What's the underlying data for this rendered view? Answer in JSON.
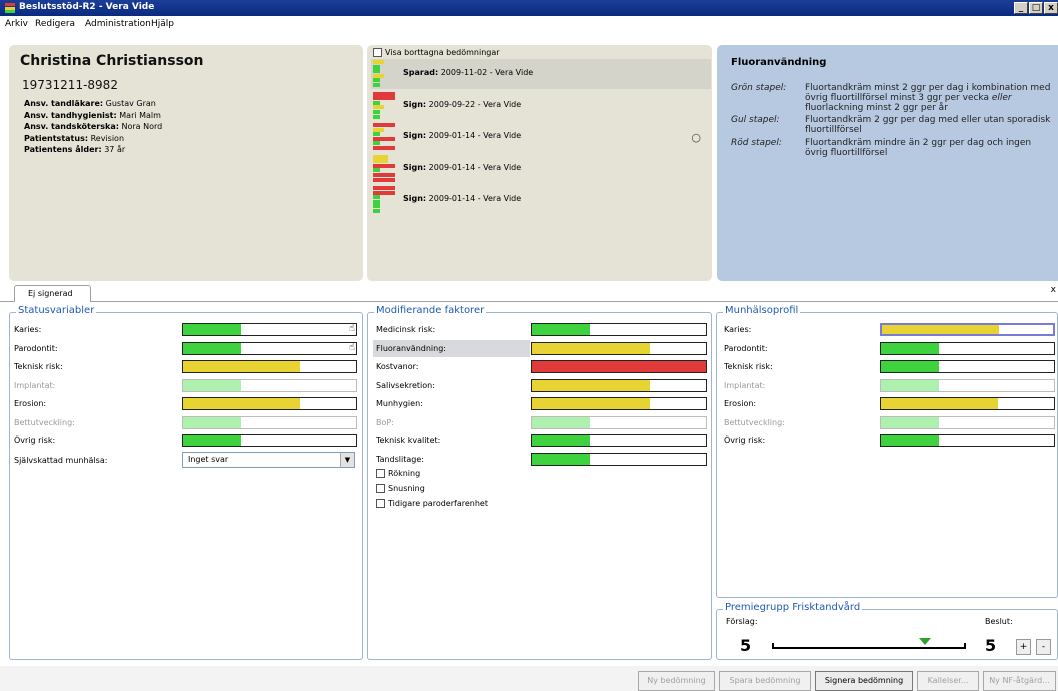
{
  "window": {
    "title": "Beslutsstöd-R2 - Vera Vide",
    "controls": [
      "_",
      "□",
      "x"
    ]
  },
  "menu": [
    "Arkiv",
    "Redigera",
    "Administration",
    "Hjälp"
  ],
  "patient": {
    "name": "Christina Christiansson",
    "id": "19731211-8982",
    "rows": [
      {
        "k": "Ansv. tandläkare:",
        "v": "Gustav Gran"
      },
      {
        "k": "Ansv. tandhygienist:",
        "v": "Mari Malm"
      },
      {
        "k": "Ansv. tandsköterska:",
        "v": "Nora Nord"
      },
      {
        "k": "Patientstatus:",
        "v": "Revision"
      },
      {
        "k": "Patientens ålder:",
        "v": "37 år"
      }
    ]
  },
  "assessments": {
    "show_removed_label": "Visa borttagna bedömningar",
    "show_removed_checked": false,
    "items": [
      {
        "status": "Sparad:",
        "text": "2009-11-02 - Vera Vide",
        "selected": true,
        "bold_text": true,
        "comment": false,
        "bars": [
          [
            "#e7d432",
            0.5
          ],
          [
            "#3fd23f",
            0.3
          ],
          [
            "#3fd23f",
            0.3
          ],
          [
            "#e7d432",
            0.5
          ],
          [
            "#3fd23f",
            0.3
          ],
          [
            "#3fd23f",
            0.3
          ]
        ]
      },
      {
        "status": "Sign:",
        "text": "2009-09-22 - Vera Vide",
        "selected": false,
        "bold_text": false,
        "comment": false,
        "bars": [
          [
            "#e03a3a",
            1.0
          ],
          [
            "#e03a3a",
            1.0
          ],
          [
            "#3fd23f",
            0.3
          ],
          [
            "#e7d432",
            0.5
          ],
          [
            "#3fd23f",
            0.3
          ],
          [
            "#3fd23f",
            0.3
          ]
        ]
      },
      {
        "status": "Sign:",
        "text": "2009-01-14 - Vera Vide",
        "selected": false,
        "bold_text": false,
        "comment": true,
        "bars": [
          [
            "#e03a3a",
            1.0
          ],
          [
            "#e7d432",
            0.5
          ],
          [
            "#3fd23f",
            0.3
          ],
          [
            "#e03a3a",
            1.0
          ],
          [
            "#3fd23f",
            0.3
          ],
          [
            "#e03a3a",
            1.0
          ]
        ]
      },
      {
        "status": "Sign:",
        "text": "2009-01-14 - Vera Vide",
        "selected": false,
        "bold_text": false,
        "comment": false,
        "bars": [
          [
            "#e7d432",
            0.7
          ],
          [
            "#e7d432",
            0.7
          ],
          [
            "#e03a3a",
            1.0
          ],
          [
            "#3fd23f",
            0.3
          ],
          [
            "#e03a3a",
            1.0
          ],
          [
            "#e03a3a",
            1.0
          ]
        ]
      },
      {
        "status": "Sign:",
        "text": "2009-01-14 - Vera Vide",
        "selected": false,
        "bold_text": false,
        "comment": false,
        "bars": [
          [
            "#e03a3a",
            1.0
          ],
          [
            "#e03a3a",
            1.0
          ],
          [
            "#3fd23f",
            0.3
          ],
          [
            "#3fd23f",
            0.3
          ],
          [
            "#3fd23f",
            0.3
          ],
          [
            "#3fd23f",
            0.3
          ]
        ]
      }
    ]
  },
  "fluor_info": {
    "title": "Fluoranvändning",
    "items": [
      {
        "key": "Grön stapel:",
        "desc_html": "Fluortandkräm minst 2 ggr per dag i kombination med övrig fluortillförsel minst 3 ggr per vecka <i>eller</i> fluorlackning minst 2 ggr per år"
      },
      {
        "key": "Gul stapel:",
        "desc_html": "Fluortandkräm 2 ggr per dag med eller utan sporadisk fluortillförsel"
      },
      {
        "key": "Röd stapel:",
        "desc_html": "Fluortandkräm mindre än 2 ggr per dag och ingen övrig fluortillförsel"
      }
    ]
  },
  "tab": {
    "label": "Ej signerad",
    "close": "x"
  },
  "status_vars": {
    "title": "Statusvariabler",
    "rows": [
      {
        "label": "Karies:",
        "color": "#3fd23f",
        "level": 0.33,
        "enabled": true,
        "hand": true
      },
      {
        "label": "Parodontit:",
        "color": "#3fd23f",
        "level": 0.33,
        "enabled": true,
        "hand": true
      },
      {
        "label": "Teknisk risk:",
        "color": "#e7d432",
        "level": 0.67,
        "enabled": true,
        "hand": false
      },
      {
        "label": "Implantat:",
        "color": "#aef0ae",
        "level": 0.33,
        "enabled": false,
        "hand": false
      },
      {
        "label": "Erosion:",
        "color": "#e7d432",
        "level": 0.67,
        "enabled": true,
        "hand": false
      },
      {
        "label": "Bettutveckling:",
        "color": "#aef0ae",
        "level": 0.33,
        "enabled": false,
        "hand": false
      },
      {
        "label": "Övrig risk:",
        "color": "#3fd23f",
        "level": 0.33,
        "enabled": true,
        "hand": false
      }
    ],
    "self_rated_label": "Självskattad munhälsa:",
    "self_rated_value": "Inget svar"
  },
  "modifying": {
    "title": "Modifierande faktorer",
    "rows": [
      {
        "label": "Medicinsk risk:",
        "color": "#3fd23f",
        "level": 0.33,
        "enabled": true,
        "selected": false
      },
      {
        "label": "Fluoranvändning:",
        "color": "#e7d432",
        "level": 0.67,
        "enabled": true,
        "selected": true
      },
      {
        "label": "Kostvanor:",
        "color": "#e03a3a",
        "level": 1.0,
        "enabled": true,
        "selected": false
      },
      {
        "label": "Salivsekretion:",
        "color": "#e7d432",
        "level": 0.67,
        "enabled": true,
        "selected": false
      },
      {
        "label": "Munhygien:",
        "color": "#e7d432",
        "level": 0.67,
        "enabled": true,
        "selected": false
      },
      {
        "label": "BoP:",
        "color": "#aef0ae",
        "level": 0.33,
        "enabled": false,
        "selected": false
      },
      {
        "label": "Teknisk kvalitet:",
        "color": "#3fd23f",
        "level": 0.33,
        "enabled": true,
        "selected": false
      },
      {
        "label": "Tandslitage:",
        "color": "#3fd23f",
        "level": 0.33,
        "enabled": true,
        "selected": false
      }
    ],
    "checkboxes": [
      {
        "label": "Rökning",
        "checked": false
      },
      {
        "label": "Snusning",
        "checked": false
      },
      {
        "label": "Tidigare paroderfarenhet",
        "checked": false
      }
    ]
  },
  "profile": {
    "title": "Munhälsoprofil",
    "rows": [
      {
        "label": "Karies:",
        "color": "#e7d432",
        "level": 0.67,
        "enabled": true,
        "highlight": true
      },
      {
        "label": "Parodontit:",
        "color": "#3fd23f",
        "level": 0.33,
        "enabled": true,
        "highlight": false
      },
      {
        "label": "Teknisk risk:",
        "color": "#3fd23f",
        "level": 0.33,
        "enabled": true,
        "highlight": false
      },
      {
        "label": "Implantat:",
        "color": "#aef0ae",
        "level": 0.33,
        "enabled": false,
        "highlight": false
      },
      {
        "label": "Erosion:",
        "color": "#e7d432",
        "level": 0.67,
        "enabled": true,
        "highlight": false
      },
      {
        "label": "Bettutveckling:",
        "color": "#aef0ae",
        "level": 0.33,
        "enabled": false,
        "highlight": false
      },
      {
        "label": "Övrig risk:",
        "color": "#3fd23f",
        "level": 0.33,
        "enabled": true,
        "highlight": false
      }
    ]
  },
  "premie": {
    "title": "Premiegrupp Frisktandvård",
    "proposal_label": "Förslag:",
    "decision_label": "Beslut:",
    "proposal_value": "5",
    "decision_value": "5",
    "plus": "+",
    "minus": "-"
  },
  "buttons": [
    {
      "label": "Ny bedömning",
      "enabled": false
    },
    {
      "label": "Spara bedömning",
      "enabled": false
    },
    {
      "label": "Signera bedömning",
      "enabled": true
    },
    {
      "label": "Kallelser...",
      "enabled": false
    },
    {
      "label": "Ny NF-åtgärd...",
      "enabled": false
    }
  ]
}
